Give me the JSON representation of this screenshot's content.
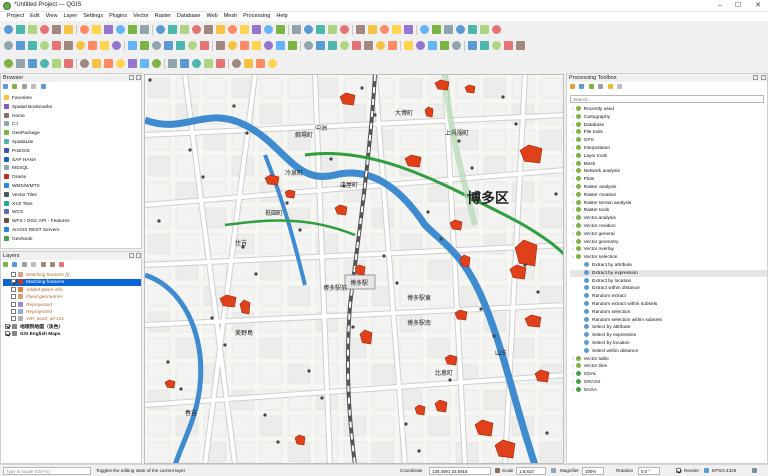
{
  "window": {
    "title": "*Untitled Project — QGIS"
  },
  "menu": [
    "Project",
    "Edit",
    "View",
    "Layer",
    "Settings",
    "Plugins",
    "Vector",
    "Raster",
    "Database",
    "Web",
    "Mesh",
    "Processing",
    "Help"
  ],
  "browser": {
    "title": "Browser",
    "items": [
      "Favorites",
      "Spatial Bookmarks",
      "Home",
      "C:\\",
      "GeoPackage",
      "SpatiaLite",
      "PostGIS",
      "SAP HANA",
      "MSSQL",
      "Oracle",
      "WMS/WMTS",
      "Vector Tiles",
      "XYZ Tiles",
      "WCS",
      "WFS / OGC API - Features",
      "ArcGIS REST Servers",
      "GeoNode"
    ]
  },
  "layers": {
    "title": "Layers",
    "items": [
      {
        "name": "Matching features [t]",
        "checked": false,
        "style": "italic",
        "color": "#c9a98a"
      },
      {
        "name": "Matching features",
        "checked": true,
        "style": "selected",
        "color": "#c0392b"
      },
      {
        "name": "Added geom info",
        "checked": false,
        "style": "italic",
        "color": "#e08040"
      },
      {
        "name": "Fixed geometries",
        "checked": false,
        "style": "italic",
        "color": "#d5a070"
      },
      {
        "name": "Reprojected",
        "checked": false,
        "style": "italic",
        "color": "#a08ad0"
      },
      {
        "name": "Reprojected",
        "checked": false,
        "style": "italic",
        "color": "#8fb0d8"
      },
      {
        "name": "VRI_ward_all-101",
        "checked": false,
        "style": "italic",
        "color": "#b0b0b0"
      },
      {
        "name": "地理院地図（淡色）",
        "checked": true,
        "style": "bold",
        "color": "#888888"
      },
      {
        "name": "GSI English Maps",
        "checked": true,
        "style": "bold",
        "color": "#888888"
      }
    ]
  },
  "toolbox": {
    "title": "Processing Toolbox",
    "search_placeholder": "Search...",
    "groups": [
      "Recently used",
      "Cartography",
      "Database",
      "File tools",
      "GPS",
      "Interpolation",
      "Layer tools",
      "Mesh",
      "Network analysis",
      "Plots",
      "Raster analysis",
      "Raster creation",
      "Raster terrain analysis",
      "Raster tools",
      "Vector analysis",
      "Vector creation",
      "Vector general",
      "Vector geometry",
      "Vector overlay",
      "Vector selection"
    ],
    "selection_children": [
      "Extract by attribute",
      "Extract by expression",
      "Extract by location",
      "Extract within distance",
      "Random extract",
      "Random extract within subsets",
      "Random selection",
      "Random selection within subsets",
      "Select by attribute",
      "Select by expression",
      "Select by location",
      "Select within distance"
    ],
    "groups_after": [
      "Vector table",
      "Vector tiles",
      "GDAL",
      "GRASS",
      "SAGA"
    ]
  },
  "map": {
    "labels": [
      "博多区",
      "博多駅前",
      "博多駅",
      "博多駅東",
      "博多駅南",
      "中洲",
      "住吉",
      "美野島",
      "春吉",
      "祇園町",
      "冷泉町",
      "店屋町",
      "綱場町",
      "大博町",
      "上呉服町",
      "比恵町",
      "山王"
    ]
  },
  "status": {
    "locate_placeholder": "Type to locate (Ctrl+K)",
    "message": "Toggles the editing state of the current layer",
    "coordinate_label": "Coordinate",
    "coordinate": "130.4091 33.5918",
    "scale_label": "Scale",
    "scale": "1:8,810",
    "magnifier_label": "Magnifier",
    "magnifier": "100%",
    "rotation_label": "Rotation",
    "rotation": "0.0 °",
    "render_label": "Render",
    "crs": "EPSG:4326"
  },
  "colors": {
    "feature_fill": "#e0401a",
    "water": "#3f8bd0",
    "rail": "#2e9e3f",
    "road": "#ffffff"
  }
}
